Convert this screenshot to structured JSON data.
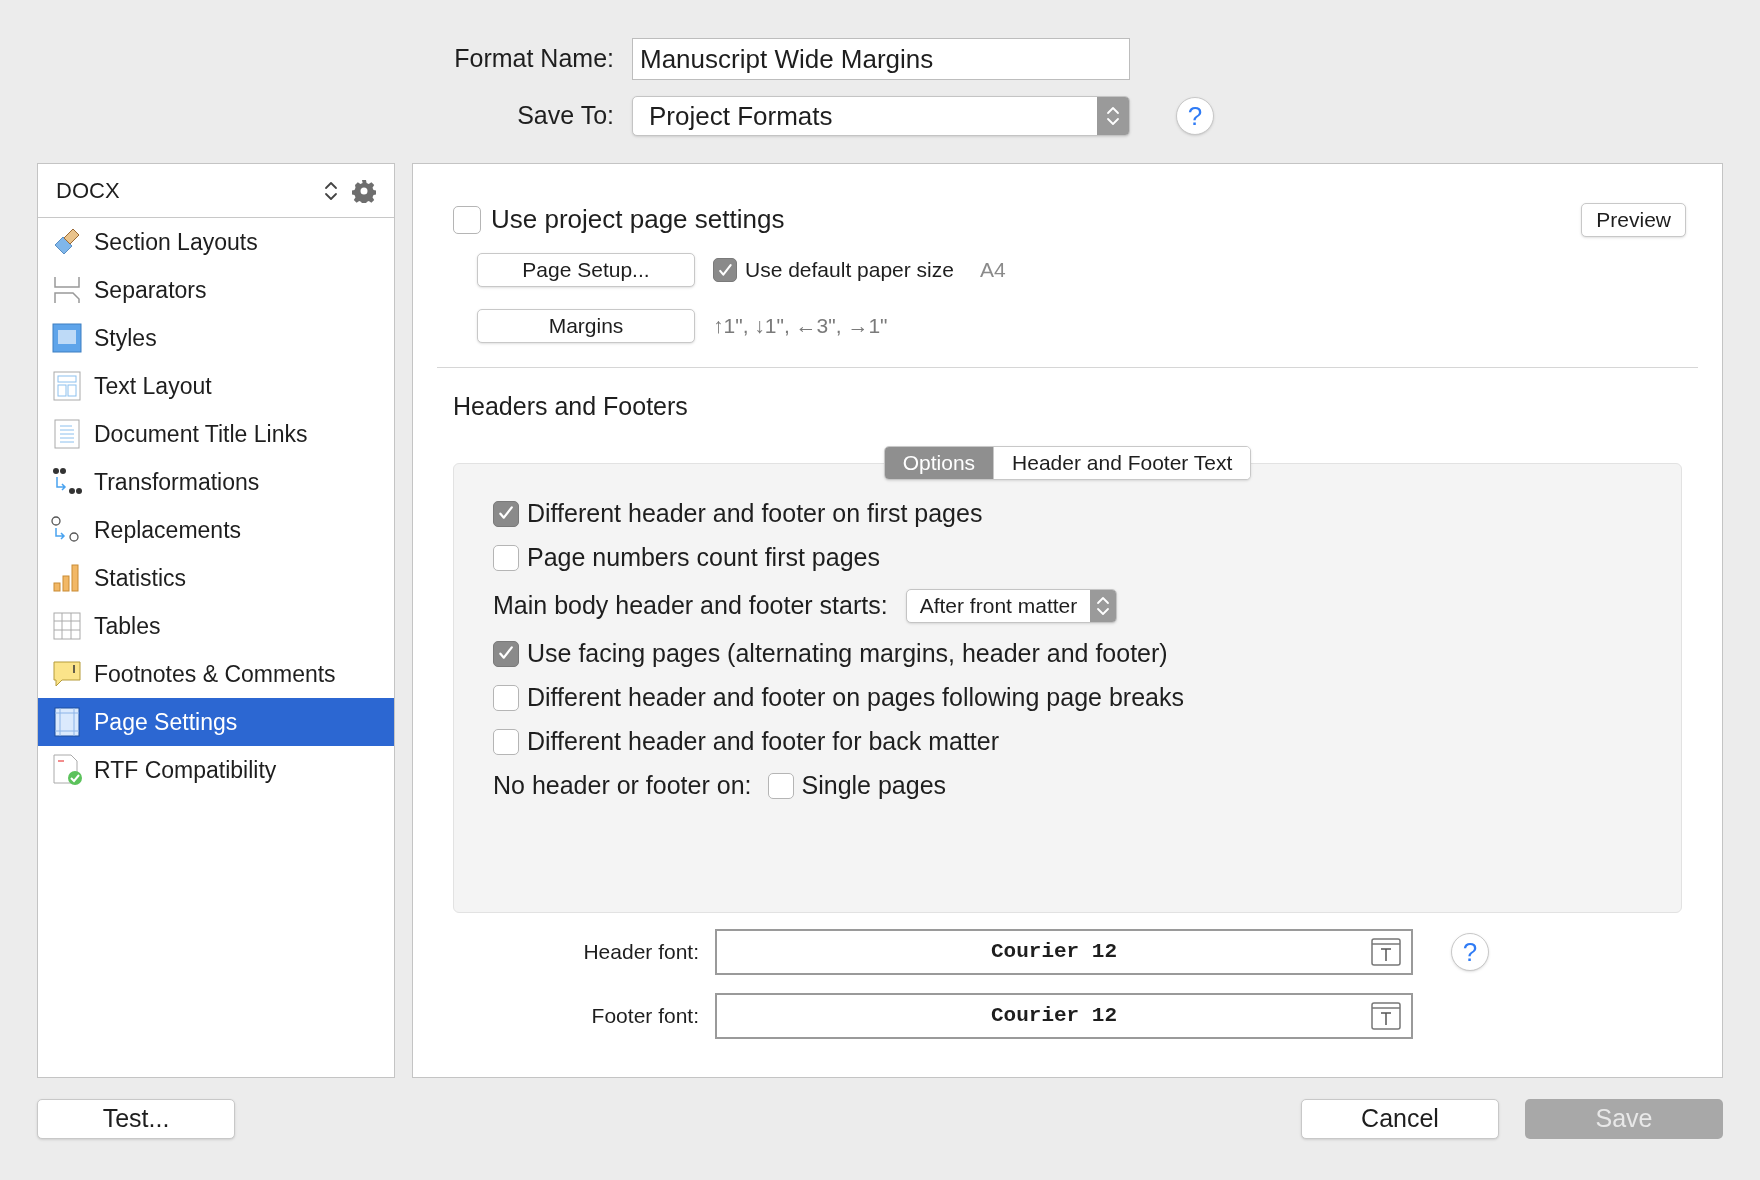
{
  "format_name": {
    "label": "Format Name:",
    "value": "Manuscript Wide Margins"
  },
  "save_to": {
    "label": "Save To:",
    "value": "Project Formats",
    "help": "?"
  },
  "sidebar": {
    "header": "DOCX",
    "items": [
      {
        "label": "Section Layouts",
        "selected": false
      },
      {
        "label": "Separators",
        "selected": false
      },
      {
        "label": "Styles",
        "selected": false
      },
      {
        "label": "Text Layout",
        "selected": false
      },
      {
        "label": "Document Title Links",
        "selected": false
      },
      {
        "label": "Transformations",
        "selected": false
      },
      {
        "label": "Replacements",
        "selected": false
      },
      {
        "label": "Statistics",
        "selected": false
      },
      {
        "label": "Tables",
        "selected": false
      },
      {
        "label": "Footnotes & Comments",
        "selected": false
      },
      {
        "label": "Page Settings",
        "selected": true
      },
      {
        "label": "RTF Compatibility",
        "selected": false
      }
    ]
  },
  "page": {
    "use_project": {
      "label": "Use project page settings",
      "checked": false
    },
    "preview_button": "Preview",
    "page_setup_button": "Page Setup...",
    "default_paper": {
      "label": "Use default paper size",
      "checked": true
    },
    "paper_size": "A4",
    "margins_button": "Margins",
    "margins_summary": "↑1\", ↓1\", ←3\", →1\""
  },
  "headers_footers": {
    "title": "Headers and Footers",
    "tabs": [
      {
        "label": "Options",
        "selected": true
      },
      {
        "label": "Header and Footer Text",
        "selected": false
      }
    ],
    "options": [
      {
        "kind": "checkbox",
        "label": "Different header and footer on first pages",
        "checked": true
      },
      {
        "kind": "checkbox",
        "label": "Page numbers count first pages",
        "checked": false
      },
      {
        "kind": "select",
        "label": "Main body header and footer starts:",
        "value": "After front matter"
      },
      {
        "kind": "checkbox",
        "label": "Use facing pages (alternating margins, header and footer)",
        "checked": true
      },
      {
        "kind": "checkbox",
        "label": "Different header and footer on pages following page breaks",
        "checked": false
      },
      {
        "kind": "checkbox",
        "label": "Different header and footer for back matter",
        "checked": false
      },
      {
        "kind": "inline_checkbox",
        "label": "No header or footer on:",
        "option_label": "Single pages",
        "checked": false
      }
    ]
  },
  "fonts": [
    {
      "label": "Header font:",
      "value": "Courier 12",
      "help": "?"
    },
    {
      "label": "Footer font:",
      "value": "Courier 12"
    }
  ],
  "buttons": {
    "test": "Test...",
    "cancel": "Cancel",
    "save": {
      "label": "Save",
      "disabled": true
    }
  }
}
